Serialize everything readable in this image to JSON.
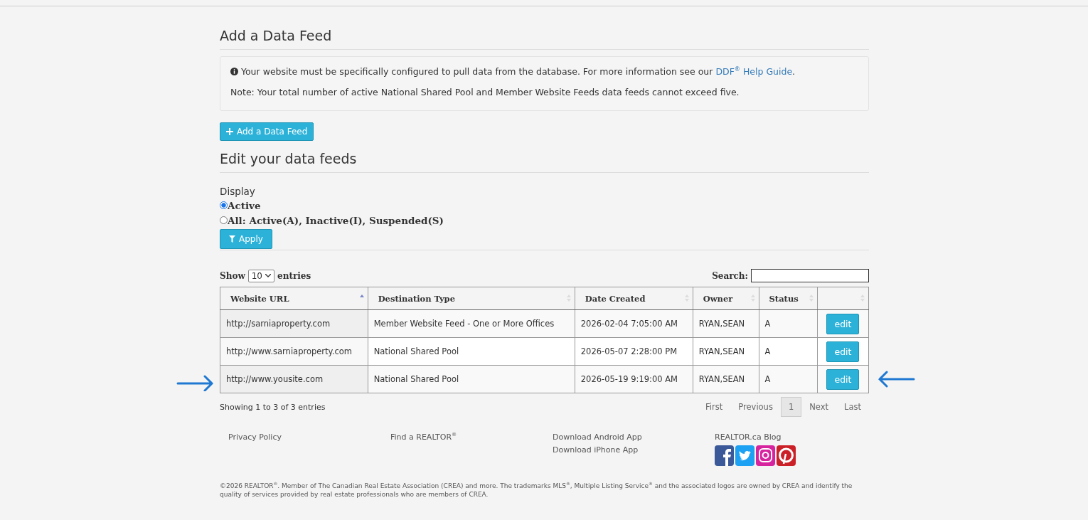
{
  "add_section": {
    "heading": "Add a Data Feed",
    "info": "Your website must be specifically configured to pull data from the database. For more information see our ",
    "info_link": "DDF$^{®}$ Help Guide",
    "info_end": ".",
    "note": "Note: Your total number of active National Shared Pool and Member Website Feeds data feeds cannot exceed five.",
    "button": "Add a Data Feed"
  },
  "edit_section": {
    "heading": "Edit your data feeds",
    "display_label": "Display",
    "options": [
      {
        "label": "Active",
        "selected": true
      },
      {
        "label": "All: Active(A), Inactive(I), Suspended(S)",
        "selected": false
      }
    ],
    "apply_button": "Apply"
  },
  "table": {
    "show_label": "Show",
    "page_size": "10",
    "entries_label": "entries",
    "search_label": "Search:",
    "columns": [
      {
        "label": "Website URL",
        "sorted": true
      },
      {
        "label": "Destination Type",
        "sorted": false
      },
      {
        "label": "Date Created",
        "sorted": false
      },
      {
        "label": "Owner",
        "sorted": false
      },
      {
        "label": "Status",
        "sorted": false
      },
      {
        "sorted": false
      }
    ],
    "rows": [
      {
        "cells": [
          "http://sarniaproperty.com",
          "Member Website Feed - One or More Offices",
          "2026-02-04 7:05:00 AM",
          "RYAN,SEAN",
          "A"
        ],
        "action": "edit",
        "marked": false
      },
      {
        "cells": [
          "http://www.sarniaproperty.com",
          "National Shared Pool",
          "2026-05-07 2:28:00 PM",
          "RYAN,SEAN",
          "A"
        ],
        "action": "edit",
        "marked": false
      },
      {
        "cells": [
          "http://www.yousite.com",
          "National Shared Pool",
          "2026-05-19 9:19:00 AM",
          "RYAN,SEAN",
          "A"
        ],
        "action": "edit",
        "marked": true
      }
    ],
    "info": "Showing 1 to 3 of 3 entries",
    "pagination": [
      {
        "label": "First",
        "selected": false
      },
      {
        "label": "Previous",
        "selected": false
      },
      {
        "label": "1",
        "selected": true
      },
      {
        "label": "Next",
        "selected": false
      },
      {
        "label": "Last",
        "selected": false
      }
    ]
  },
  "footer": {
    "columns": [
      [
        "Privacy Policy"
      ],
      [
        "Find a REALTOR$^{®}$"
      ],
      [
        "Download Android App",
        "Download iPhone App"
      ],
      [
        "REALTOR.ca Blog"
      ]
    ],
    "copyright": "©2026 REALTOR$^{®}$. Member of The Canadian Real Estate Association (CREA) and more. The trademarks MLS$^{®}$, Multiple Listing Service$^{®}$ and the associated logos are owned by CREA and identify the quality of services provided by real estate professionals who are members of CREA."
  }
}
